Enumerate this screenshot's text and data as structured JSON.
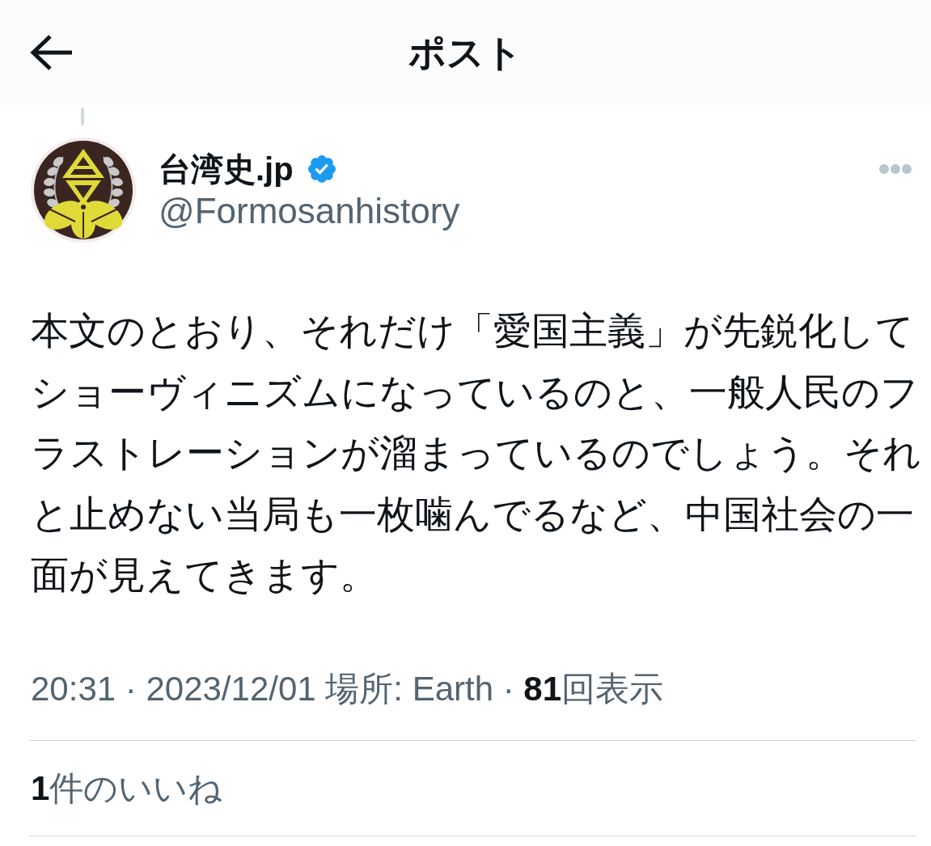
{
  "header": {
    "title": "ポスト"
  },
  "author": {
    "name": "台湾史.jp",
    "verified": true,
    "handle": "@Formosanhistory"
  },
  "post": {
    "text": "本文のとおり、それだけ「愛国主義」が先鋭化してショーヴィニズムになっているのと、一般人民のフラストレーションが溜まっているのでしょう。それと止めない当局も一枚噛んでるなど、中国社会の一面が見えてきます。",
    "meta": "20:31 · 2023/12/01 場所: Earth · **81**回表示",
    "likes": "**1**件のいいね"
  }
}
